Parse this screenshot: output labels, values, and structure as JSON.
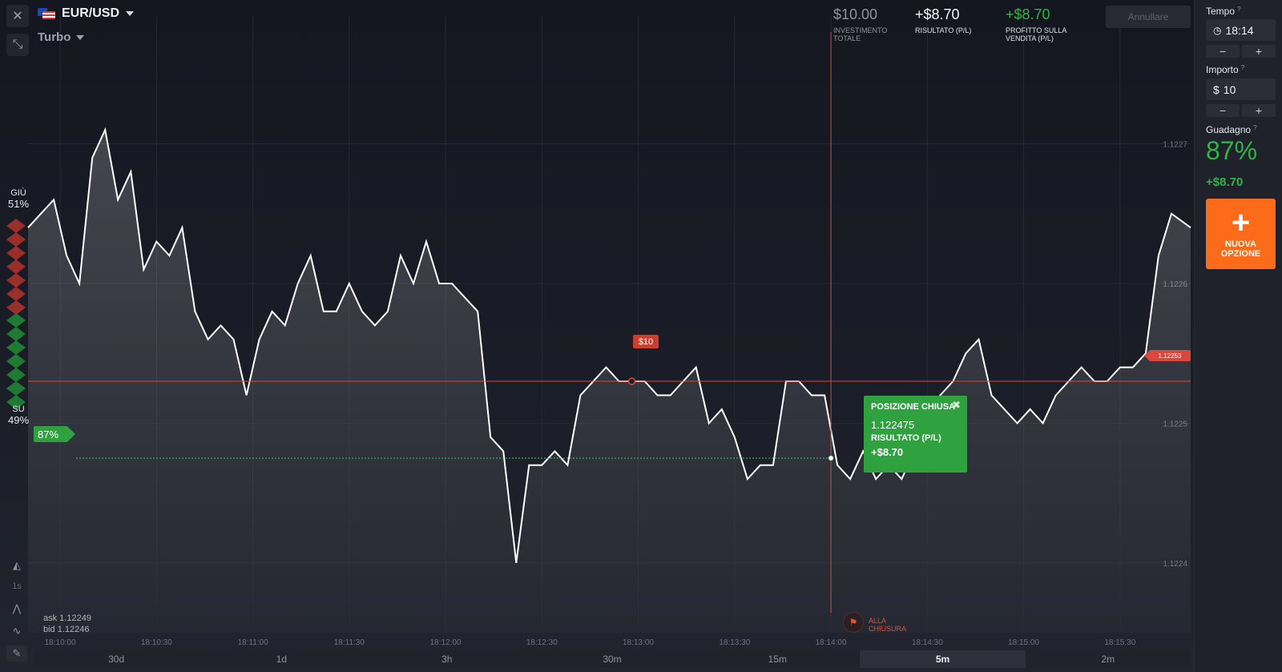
{
  "header": {
    "pair": "EUR/USD",
    "mode": "Turbo",
    "investment_value": "$10.00",
    "investment_label": "INVESTIMENTO TOTALE",
    "result_value": "+$8.70",
    "result_label": "RISULTATO (P/L)",
    "sale_profit_value": "+$8.70",
    "sale_profit_label": "PROFITTO SULLA VENDITA (P/L)",
    "cancel_label": "Annullare"
  },
  "sidebar": {
    "time_label": "Tempo",
    "time_value": "18:14",
    "amount_label": "Importo",
    "amount_currency": "$",
    "amount_value": "10",
    "minus": "−",
    "plus": "+",
    "gain_label": "Guadagno",
    "gain_pct": "87%",
    "gain_value": "+$8.70",
    "new_option_plus": "+",
    "new_option_label": "NUOVA OPZIONE",
    "help_mark": "?"
  },
  "sentiment": {
    "down_label": "GIÙ",
    "down_pct": "51%",
    "up_label": "SU",
    "up_pct": "49%"
  },
  "chart": {
    "y_ticks": [
      "1.1227",
      "1.1226",
      "1.1225",
      "1.1224"
    ],
    "x_ticks": [
      "18:10:00",
      "18:10:30",
      "18:11:00",
      "18:11:30",
      "18:12:00",
      "18:12:30",
      "18:13:00",
      "18:13:30",
      "18:14:00",
      "18:14:30",
      "18:15:00",
      "18:15:30"
    ],
    "current_price_tag": "1.12253",
    "entry_amount_tag": "$10",
    "payout_tag": "87%",
    "closure_label": "ALLA CHIUSURA",
    "ask": "ask 1.12249",
    "bid": "bid 1.12246"
  },
  "popup": {
    "title": "POSIZIONE CHIUSA",
    "price": "1.122475",
    "result_label": "RISULTATO (P/L)",
    "result_value": "+$8.70",
    "close_icon": "✖"
  },
  "tools": {
    "interval_label": "1s"
  },
  "timeframes": [
    "30d",
    "1d",
    "3h",
    "30m",
    "15m",
    "5m",
    "2m"
  ],
  "active_timeframe": "5m",
  "colors": {
    "accent": "#fb6b19",
    "green": "#2fa23f",
    "red": "#e0503b",
    "line": "#ffffff"
  },
  "chart_data": {
    "type": "line",
    "title": "",
    "xlabel": "",
    "ylabel": "",
    "x_range": [
      "18:09:50",
      "18:15:52"
    ],
    "ylim": [
      1.12235,
      1.12278
    ],
    "grid": true,
    "entry_price": 1.12253,
    "closing_price": 1.122475,
    "series": [
      {
        "x": [
          "18:09:50",
          "18:09:58",
          "18:10:02",
          "18:10:06",
          "18:10:10",
          "18:10:14",
          "18:10:18",
          "18:10:22",
          "18:10:26",
          "18:10:30",
          "18:10:34",
          "18:10:38",
          "18:10:42",
          "18:10:46",
          "18:10:50",
          "18:10:54",
          "18:10:58",
          "18:11:02",
          "18:11:06",
          "18:11:10",
          "18:11:14",
          "18:11:18",
          "18:11:22",
          "18:11:26",
          "18:11:30",
          "18:11:34",
          "18:11:38",
          "18:11:42",
          "18:11:46",
          "18:11:50",
          "18:11:54",
          "18:11:58",
          "18:12:02",
          "18:12:06",
          "18:12:10",
          "18:12:14",
          "18:12:18",
          "18:12:22",
          "18:12:26",
          "18:12:30",
          "18:12:34",
          "18:12:38",
          "18:12:42",
          "18:12:46",
          "18:12:50",
          "18:12:54",
          "18:12:58",
          "18:13:02",
          "18:13:06",
          "18:13:10",
          "18:13:14",
          "18:13:18",
          "18:13:22",
          "18:13:26",
          "18:13:30",
          "18:13:34",
          "18:13:38",
          "18:13:42",
          "18:13:46",
          "18:13:50",
          "18:13:54",
          "18:13:58",
          "18:14:02",
          "18:14:06",
          "18:14:10",
          "18:14:14",
          "18:14:18",
          "18:14:22",
          "18:14:26",
          "18:14:30",
          "18:14:34",
          "18:14:38",
          "18:14:42",
          "18:14:46",
          "18:14:50",
          "18:14:54",
          "18:14:58",
          "18:15:02",
          "18:15:06",
          "18:15:10",
          "18:15:14",
          "18:15:18",
          "18:15:22",
          "18:15:26",
          "18:15:30",
          "18:15:34",
          "18:15:38",
          "18:15:42",
          "18:15:46",
          "18:15:52"
        ],
        "values": [
          1.12264,
          1.12266,
          1.12262,
          1.1226,
          1.12269,
          1.12271,
          1.12266,
          1.12268,
          1.12261,
          1.12263,
          1.12262,
          1.12264,
          1.12258,
          1.12256,
          1.12257,
          1.12256,
          1.12252,
          1.12256,
          1.12258,
          1.12257,
          1.1226,
          1.12262,
          1.12258,
          1.12258,
          1.1226,
          1.12258,
          1.12257,
          1.12258,
          1.12262,
          1.1226,
          1.12263,
          1.1226,
          1.1226,
          1.12259,
          1.12258,
          1.12249,
          1.12248,
          1.1224,
          1.12247,
          1.12247,
          1.12248,
          1.12247,
          1.12252,
          1.12253,
          1.12254,
          1.12253,
          1.12253,
          1.12253,
          1.12252,
          1.12252,
          1.12253,
          1.12254,
          1.1225,
          1.12251,
          1.12249,
          1.12246,
          1.12247,
          1.12247,
          1.12253,
          1.12253,
          1.12252,
          1.12252,
          1.12247,
          1.12246,
          1.12248,
          1.12246,
          1.12247,
          1.12246,
          1.12248,
          1.1225,
          1.12252,
          1.12253,
          1.12255,
          1.12256,
          1.12252,
          1.12251,
          1.1225,
          1.12251,
          1.1225,
          1.12252,
          1.12253,
          1.12254,
          1.12253,
          1.12253,
          1.12254,
          1.12254,
          1.12255,
          1.12262,
          1.12265,
          1.12264
        ]
      }
    ]
  }
}
